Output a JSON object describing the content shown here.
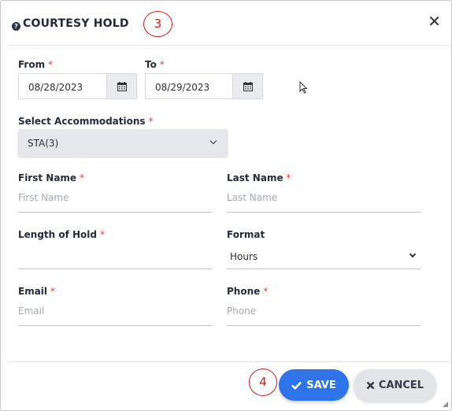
{
  "modal": {
    "title": "COURTESY HOLD",
    "help_icon": "question-circle-icon",
    "close_icon": "close-icon",
    "close_glyph": "✕"
  },
  "callouts": {
    "title_step": "3",
    "save_step": "4"
  },
  "form": {
    "from": {
      "label": "From",
      "value": "08/28/2023",
      "icon": "calendar-icon"
    },
    "to": {
      "label": "To",
      "value": "08/29/2023",
      "icon": "calendar-icon"
    },
    "accommodations": {
      "label": "Select Accommodations",
      "value": "STA(3)"
    },
    "first_name": {
      "label": "First Name",
      "placeholder": "First Name",
      "value": ""
    },
    "last_name": {
      "label": "Last Name",
      "placeholder": "Last Name",
      "value": ""
    },
    "length_of_hold": {
      "label": "Length of Hold",
      "placeholder": "",
      "value": ""
    },
    "format": {
      "label": "Format",
      "value": "Hours"
    },
    "email": {
      "label": "Email",
      "placeholder": "Email",
      "value": ""
    },
    "phone": {
      "label": "Phone",
      "placeholder": "Phone",
      "value": ""
    },
    "required_marker": "*"
  },
  "buttons": {
    "save": {
      "label": "SAVE",
      "icon": "check-icon"
    },
    "cancel": {
      "label": "CANCEL",
      "icon": "close-icon"
    }
  },
  "colors": {
    "primary": "#2f73ea",
    "required": "#e0403a",
    "callout": "#d11a1a"
  }
}
